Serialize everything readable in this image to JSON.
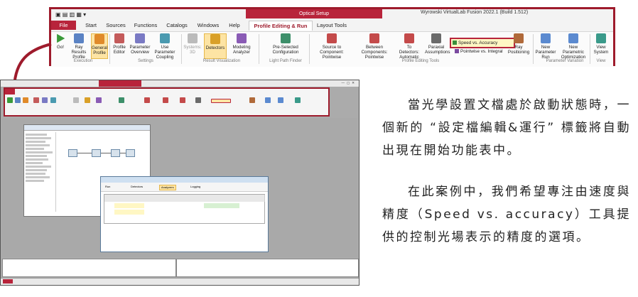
{
  "ribbon": {
    "quick_access_symbol": "▾",
    "context_tab": "Optical Setup",
    "window_title": "Wyrowski VirtualLab Fusion 2022.1 (Build 1.512)",
    "tabs": [
      {
        "label": "File"
      },
      {
        "label": "Start"
      },
      {
        "label": "Sources"
      },
      {
        "label": "Functions"
      },
      {
        "label": "Catalogs"
      },
      {
        "label": "Windows"
      },
      {
        "label": "Help"
      },
      {
        "label": "Profile Editing & Run"
      },
      {
        "label": "Layout Tools"
      }
    ],
    "buttons": {
      "go": "Go!",
      "ray_results_profile": "Ray Results Profile",
      "general_profile": "General Profile",
      "profile_editor": "Profile Editor",
      "parameter_overview": "Parameter Overview",
      "use_parameter_coupling": "Use Parameter Coupling",
      "systems_3d": "Systems: 3D",
      "detectors": "Detectors",
      "modeling_analyzer": "Modeling Analyzer",
      "pre_selected_configuration": "Pre-Selected Configuration",
      "source_to_component": "Source to Component: Pointwise",
      "between_components": "Between Components: Pointwise",
      "to_detectors": "To Detectors: Automatic",
      "paraxial_assumptions": "Paraxial Assumptions",
      "speed_vs_accuracy": "Speed vs. Accuracy",
      "pointwise_vs_integral": "Pointwise vs. Integral",
      "ray_positioning": "Ray Positioning",
      "new_parameter_run": "New Parameter Run",
      "new_parametric_optimization": "New Parametric Optimization",
      "view_system": "View System"
    },
    "groups": {
      "execution": "Execution",
      "settings": "Settings",
      "result_visualization": "Result Visualization",
      "light_path_finder": "Light Path Finder",
      "profile_editing_tools": "Profile Editing Tools",
      "parameter_variation": "Parameter Variation",
      "view": "View"
    },
    "colors": {
      "accent": "#9e1b2c",
      "highlight": "#fde4a4"
    }
  },
  "app": {
    "profile_editor": {
      "toolbar": {
        "run": "Run",
        "detectors": "Detectors",
        "analyzers": "Analyzers",
        "logging": "Logging"
      }
    }
  },
  "text": {
    "p1": "當光學設置文檔處於啟動狀態時，一個新的 “設定檔編輯&運行” 標籤將自動出現在開始功能表中。",
    "p2": "在此案例中，我們希望專注由速度與精度（Speed vs. accuracy）工具提供的控制光場表示的精度的選項。"
  }
}
